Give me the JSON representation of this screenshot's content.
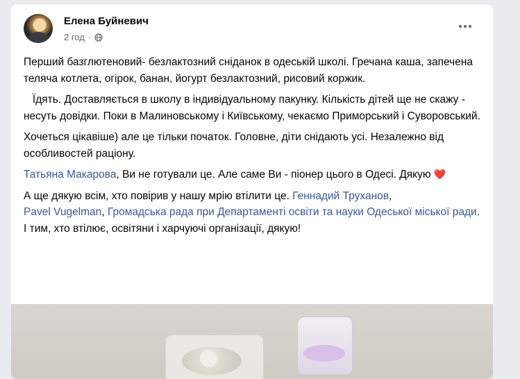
{
  "post": {
    "author": "Елена Буйневич",
    "time": "2 год",
    "dot": "·",
    "privacy_icon": "globe-icon",
    "more_icon": "more-dots-icon"
  },
  "text": {
    "p1": "Перший базглютеновий- безлактозний  сніданок в одеській школі. Гречана каша, запечена теляча котлета, огірок, банан, йогурт безлактозний, рисовий коржик.",
    "p2": "Їдять. Доставляється в школу в індивідуальному пакунку. Кількість дітей ще не скажу - несуть довідки. Поки в Малиновському і Київському, чекаємо Приморський і Суворовський.",
    "p3": "Хочеться цікавіше) але це тільки початок. Головне, діти снідають усі. Незалежно від особливостей раціону.",
    "p4_link": "Татьяна Макарова",
    "p4_rest": ", Ви не готували це. Але саме Ви - піонер цього в Одесі. Дякую ",
    "heart": "❤️",
    "p5_start": "А ще дякую всім, хто повірив у нашу мрію втілити це. ",
    "p5_link1": "Геннадий Труханов",
    "p5_sep1": ",",
    "p5_link2": "Pavel Vugelman",
    "p5_sep2": ", ",
    "p5_link3": "Громадська рада при Департаменті освіти та науки Одеської міської ради",
    "p5_end": ".",
    "p6": "І тим, хто втілює, освітяни і харчуючі організації, дякую!"
  },
  "colors": {
    "link": "#385898",
    "text": "#050505",
    "meta": "#65676b"
  }
}
